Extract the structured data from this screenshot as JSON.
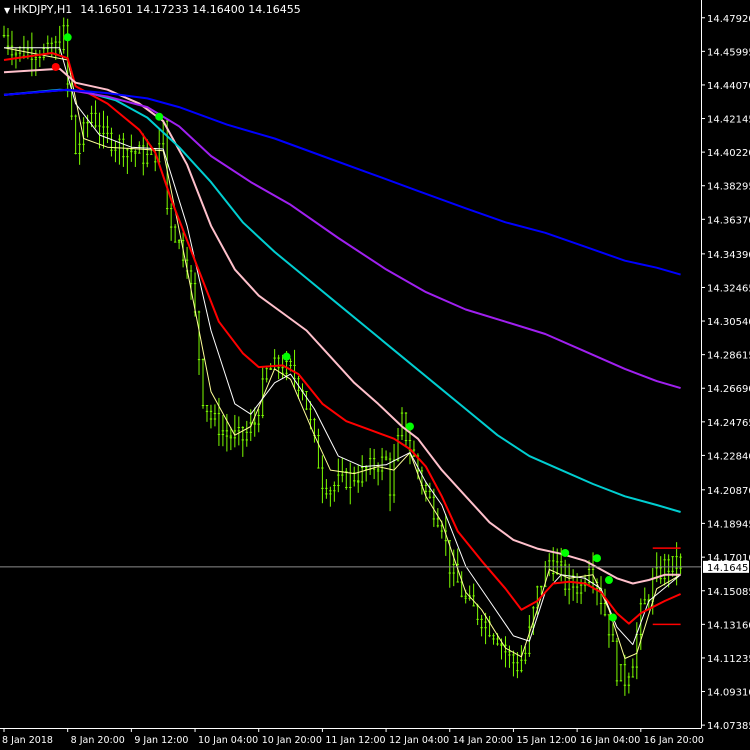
{
  "header": {
    "symbol": "HKDJPY,H1",
    "ohlc": [
      "14.16501",
      "14.17233",
      "14.16400",
      "14.16455"
    ]
  },
  "colors": {
    "background": "#000000",
    "candles": "#7CFC00",
    "axis": "#FFFFFF",
    "current_price_line": "#8C8C8C",
    "current_price_label_bg": "#FFFFFF",
    "signal_up": "#00FF00",
    "signal_down": "#FF0000"
  },
  "chart_data": {
    "type": "line",
    "subtype": "candlestick-with-moving-averages",
    "symbol": "HKDJPY",
    "timeframe": "H1",
    "grid": false,
    "current_price": 14.16455,
    "ylim": [
      14.0722,
      14.4825
    ],
    "y_ticks": [
      "14.47920",
      "14.45995",
      "14.44070",
      "14.42145",
      "14.40220",
      "14.38295",
      "14.36370",
      "14.34390",
      "14.32465",
      "14.30540",
      "14.28615",
      "14.26690",
      "14.24765",
      "14.22840",
      "14.20870",
      "14.18945",
      "14.17010",
      "14.15085",
      "14.13160",
      "14.11235",
      "14.09310",
      "14.07385"
    ],
    "x_ticks": [
      "8 Jan 2018",
      "8 Jan 20:00",
      "9 Jan 12:00",
      "10 Jan 04:00",
      "10 Jan 20:00",
      "11 Jan 12:00",
      "12 Jan 04:00",
      "14 Jan 20:00",
      "15 Jan 12:00",
      "16 Jan 04:00",
      "16 Jan 20:00"
    ],
    "x_tick_bars": [
      0,
      16,
      32,
      48,
      64,
      80,
      96,
      112,
      128,
      144,
      160
    ],
    "price_path": [
      [
        0,
        14.469
      ],
      [
        3,
        14.46
      ],
      [
        8,
        14.461
      ],
      [
        12,
        14.458
      ],
      [
        15,
        14.47
      ],
      [
        16,
        14.44
      ],
      [
        18,
        14.402
      ],
      [
        22,
        14.425
      ],
      [
        25,
        14.411
      ],
      [
        28,
        14.408
      ],
      [
        32,
        14.403
      ],
      [
        36,
        14.399
      ],
      [
        39,
        14.403
      ],
      [
        40,
        14.42
      ],
      [
        41,
        14.37
      ],
      [
        43,
        14.355
      ],
      [
        46,
        14.34
      ],
      [
        48,
        14.308
      ],
      [
        50,
        14.262
      ],
      [
        52,
        14.25
      ],
      [
        56,
        14.24
      ],
      [
        60,
        14.238
      ],
      [
        63,
        14.247
      ],
      [
        66,
        14.276
      ],
      [
        69,
        14.28
      ],
      [
        72,
        14.276
      ],
      [
        75,
        14.268
      ],
      [
        78,
        14.235
      ],
      [
        80,
        14.214
      ],
      [
        82,
        14.21
      ],
      [
        86,
        14.215
      ],
      [
        90,
        14.218
      ],
      [
        94,
        14.224
      ],
      [
        96,
        14.225
      ],
      [
        97,
        14.21
      ],
      [
        100,
        14.248
      ],
      [
        101,
        14.24
      ],
      [
        104,
        14.22
      ],
      [
        106,
        14.207
      ],
      [
        108,
        14.198
      ],
      [
        110,
        14.19
      ],
      [
        112,
        14.165
      ],
      [
        116,
        14.145
      ],
      [
        120,
        14.135
      ],
      [
        124,
        14.125
      ],
      [
        127,
        14.112
      ],
      [
        129,
        14.108
      ],
      [
        131,
        14.115
      ],
      [
        134,
        14.15
      ],
      [
        137,
        14.168
      ],
      [
        139,
        14.165
      ],
      [
        141,
        14.155
      ],
      [
        145,
        14.153
      ],
      [
        147,
        14.168
      ],
      [
        149,
        14.155
      ],
      [
        152,
        14.13
      ],
      [
        154,
        14.105
      ],
      [
        156,
        14.1
      ],
      [
        158,
        14.112
      ],
      [
        160,
        14.138
      ],
      [
        163,
        14.155
      ],
      [
        166,
        14.165
      ],
      [
        168,
        14.165
      ],
      [
        170,
        14.167
      ]
    ],
    "series": [
      {
        "color": "#FFFF99",
        "values": [
          [
            0,
            14.462
          ],
          [
            16,
            14.455
          ],
          [
            20,
            14.41
          ],
          [
            26,
            14.405
          ],
          [
            34,
            14.404
          ],
          [
            40,
            14.403
          ],
          [
            46,
            14.335
          ],
          [
            52,
            14.265
          ],
          [
            58,
            14.24
          ],
          [
            62,
            14.245
          ],
          [
            68,
            14.278
          ],
          [
            72,
            14.272
          ],
          [
            78,
            14.24
          ],
          [
            82,
            14.22
          ],
          [
            88,
            14.218
          ],
          [
            94,
            14.222
          ],
          [
            98,
            14.22
          ],
          [
            102,
            14.23
          ],
          [
            106,
            14.205
          ],
          [
            110,
            14.19
          ],
          [
            116,
            14.15
          ],
          [
            120,
            14.14
          ],
          [
            126,
            14.118
          ],
          [
            130,
            14.113
          ],
          [
            134,
            14.14
          ],
          [
            137,
            14.163
          ],
          [
            142,
            14.158
          ],
          [
            148,
            14.16
          ],
          [
            152,
            14.14
          ],
          [
            156,
            14.112
          ],
          [
            159,
            14.115
          ],
          [
            164,
            14.152
          ],
          [
            170,
            14.16
          ]
        ]
      },
      {
        "color": "#FFFFFF",
        "values": [
          [
            0,
            14.462
          ],
          [
            14,
            14.462
          ],
          [
            18,
            14.43
          ],
          [
            24,
            14.412
          ],
          [
            32,
            14.405
          ],
          [
            40,
            14.404
          ],
          [
            46,
            14.36
          ],
          [
            52,
            14.3
          ],
          [
            58,
            14.258
          ],
          [
            62,
            14.252
          ],
          [
            68,
            14.27
          ],
          [
            72,
            14.275
          ],
          [
            78,
            14.255
          ],
          [
            84,
            14.228
          ],
          [
            90,
            14.222
          ],
          [
            96,
            14.223
          ],
          [
            102,
            14.23
          ],
          [
            106,
            14.213
          ],
          [
            110,
            14.2
          ],
          [
            116,
            14.165
          ],
          [
            122,
            14.145
          ],
          [
            128,
            14.125
          ],
          [
            132,
            14.122
          ],
          [
            136,
            14.15
          ],
          [
            140,
            14.16
          ],
          [
            146,
            14.158
          ],
          [
            150,
            14.152
          ],
          [
            154,
            14.13
          ],
          [
            158,
            14.12
          ],
          [
            162,
            14.145
          ],
          [
            170,
            14.16
          ]
        ]
      },
      {
        "color": "#FF0000",
        "values": [
          [
            0,
            14.455
          ],
          [
            12,
            14.459
          ],
          [
            16,
            14.456
          ],
          [
            18,
            14.44
          ],
          [
            26,
            14.43
          ],
          [
            34,
            14.415
          ],
          [
            38,
            14.402
          ],
          [
            42,
            14.375
          ],
          [
            48,
            14.34
          ],
          [
            54,
            14.305
          ],
          [
            60,
            14.287
          ],
          [
            64,
            14.279
          ],
          [
            70,
            14.28
          ],
          [
            74,
            14.275
          ],
          [
            80,
            14.258
          ],
          [
            86,
            14.248
          ],
          [
            92,
            14.243
          ],
          [
            98,
            14.238
          ],
          [
            102,
            14.232
          ],
          [
            106,
            14.222
          ],
          [
            110,
            14.205
          ],
          [
            114,
            14.185
          ],
          [
            120,
            14.168
          ],
          [
            126,
            14.152
          ],
          [
            130,
            14.14
          ],
          [
            134,
            14.145
          ],
          [
            138,
            14.155
          ],
          [
            142,
            14.156
          ],
          [
            146,
            14.155
          ],
          [
            150,
            14.15
          ],
          [
            154,
            14.138
          ],
          [
            157,
            14.132
          ],
          [
            160,
            14.138
          ],
          [
            166,
            14.145
          ],
          [
            170,
            14.149
          ]
        ]
      },
      {
        "color": "#FFC0CB",
        "values": [
          [
            0,
            14.448
          ],
          [
            14,
            14.45
          ],
          [
            18,
            14.442
          ],
          [
            26,
            14.438
          ],
          [
            34,
            14.43
          ],
          [
            40,
            14.42
          ],
          [
            46,
            14.395
          ],
          [
            52,
            14.36
          ],
          [
            58,
            14.335
          ],
          [
            64,
            14.32
          ],
          [
            70,
            14.31
          ],
          [
            76,
            14.3
          ],
          [
            82,
            14.285
          ],
          [
            88,
            14.27
          ],
          [
            94,
            14.258
          ],
          [
            100,
            14.245
          ],
          [
            104,
            14.238
          ],
          [
            110,
            14.22
          ],
          [
            116,
            14.205
          ],
          [
            122,
            14.19
          ],
          [
            128,
            14.18
          ],
          [
            134,
            14.175
          ],
          [
            140,
            14.172
          ],
          [
            146,
            14.168
          ],
          [
            150,
            14.163
          ],
          [
            154,
            14.158
          ],
          [
            158,
            14.155
          ],
          [
            162,
            14.157
          ],
          [
            166,
            14.16
          ],
          [
            170,
            14.16
          ]
        ]
      },
      {
        "color": "#00CED1",
        "values": [
          [
            0,
            14.435
          ],
          [
            14,
            14.438
          ],
          [
            20,
            14.437
          ],
          [
            28,
            14.432
          ],
          [
            36,
            14.422
          ],
          [
            44,
            14.405
          ],
          [
            52,
            14.385
          ],
          [
            60,
            14.362
          ],
          [
            68,
            14.345
          ],
          [
            76,
            14.33
          ],
          [
            84,
            14.315
          ],
          [
            92,
            14.3
          ],
          [
            100,
            14.285
          ],
          [
            108,
            14.27
          ],
          [
            116,
            14.255
          ],
          [
            124,
            14.24
          ],
          [
            132,
            14.228
          ],
          [
            140,
            14.22
          ],
          [
            148,
            14.212
          ],
          [
            156,
            14.205
          ],
          [
            164,
            14.2
          ],
          [
            170,
            14.196
          ]
        ]
      },
      {
        "color": "#A020F0",
        "values": [
          [
            0,
            14.435
          ],
          [
            16,
            14.438
          ],
          [
            26,
            14.434
          ],
          [
            36,
            14.428
          ],
          [
            44,
            14.417
          ],
          [
            52,
            14.4
          ],
          [
            62,
            14.385
          ],
          [
            72,
            14.372
          ],
          [
            84,
            14.353
          ],
          [
            96,
            14.335
          ],
          [
            106,
            14.322
          ],
          [
            116,
            14.312
          ],
          [
            126,
            14.305
          ],
          [
            136,
            14.298
          ],
          [
            146,
            14.288
          ],
          [
            156,
            14.278
          ],
          [
            164,
            14.271
          ],
          [
            170,
            14.267
          ]
        ]
      },
      {
        "color": "#0000FF",
        "values": [
          [
            0,
            14.435
          ],
          [
            16,
            14.438
          ],
          [
            26,
            14.436
          ],
          [
            36,
            14.433
          ],
          [
            44,
            14.428
          ],
          [
            56,
            14.418
          ],
          [
            68,
            14.41
          ],
          [
            80,
            14.4
          ],
          [
            92,
            14.39
          ],
          [
            104,
            14.38
          ],
          [
            116,
            14.37
          ],
          [
            126,
            14.362
          ],
          [
            136,
            14.356
          ],
          [
            146,
            14.348
          ],
          [
            156,
            14.34
          ],
          [
            164,
            14.336
          ],
          [
            170,
            14.332
          ]
        ]
      }
    ],
    "levels": [
      {
        "color": "#FF0000",
        "value": 14.1753,
        "from_bar": 163,
        "to_bar": 170
      },
      {
        "color": "#FF0000",
        "value": 14.1316,
        "from_bar": 163,
        "to_bar": 170
      }
    ],
    "markers": [
      {
        "color": "#00FF00",
        "bar": 16,
        "value": 14.468
      },
      {
        "color": "#FF0000",
        "bar": 13,
        "value": 14.451
      },
      {
        "color": "#00FF00",
        "bar": 39,
        "value": 14.4225
      },
      {
        "color": "#00FF00",
        "bar": 71,
        "value": 14.285
      },
      {
        "color": "#00FF00",
        "bar": 102,
        "value": 14.245
      },
      {
        "color": "#00FF00",
        "bar": 141,
        "value": 14.1725
      },
      {
        "color": "#00FF00",
        "bar": 149,
        "value": 14.1695
      },
      {
        "color": "#00FF00",
        "bar": 152,
        "value": 14.157
      },
      {
        "color": "#00FF00",
        "bar": 153,
        "value": 14.1355
      }
    ]
  }
}
